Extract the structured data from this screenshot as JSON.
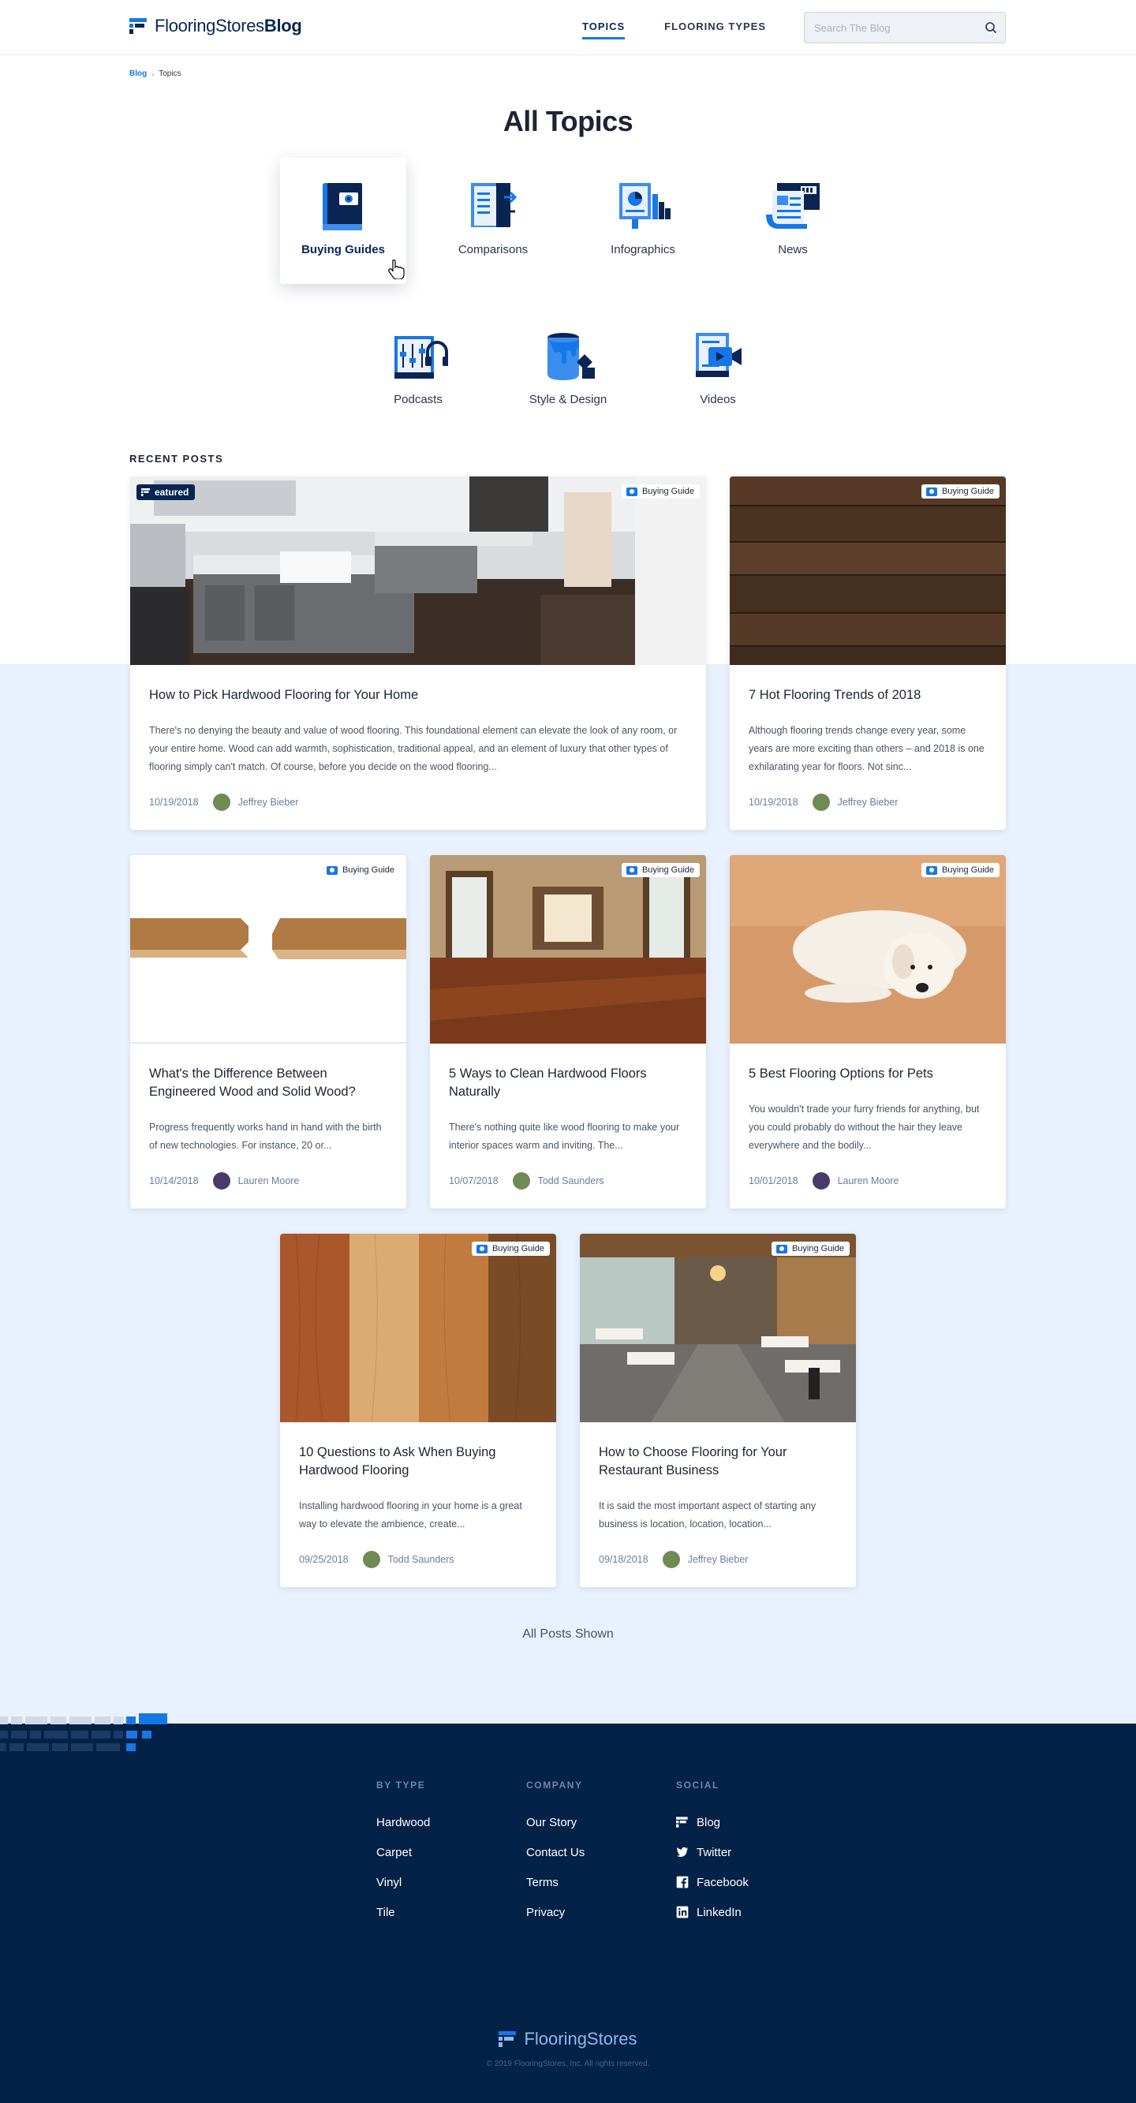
{
  "header": {
    "logo_text": "FlooringStores",
    "logo_blog": "Blog",
    "nav": [
      {
        "label": "TOPICS",
        "active": true
      },
      {
        "label": "FLOORING TYPES",
        "active": false
      }
    ],
    "search_placeholder": "Search The Blog"
  },
  "breadcrumb": {
    "root": "Blog",
    "current": "Topics"
  },
  "page_title": "All Topics",
  "topics": [
    {
      "label": "Buying Guides",
      "icon": "book-icon",
      "active": true
    },
    {
      "label": "Comparisons",
      "icon": "comparison-icon",
      "active": false
    },
    {
      "label": "Infographics",
      "icon": "chart-board-icon",
      "active": false
    },
    {
      "label": "News",
      "icon": "newspaper-icon",
      "active": false
    },
    {
      "label": "Podcasts",
      "icon": "podcast-icon",
      "active": false
    },
    {
      "label": "Style & Design",
      "icon": "paint-bucket-icon",
      "active": false
    },
    {
      "label": "Videos",
      "icon": "video-icon",
      "active": false
    }
  ],
  "recent_posts_label": "RECENT POSTS",
  "posts": [
    {
      "title": "How to Pick Hardwood Flooring for Your Home",
      "excerpt": "There's no denying the beauty and value of wood flooring.  This foundational element can elevate the look of any room, or your entire home.  Wood can add warmth, sophistication, traditional appeal, and an element of luxury that other types of flooring simply can't match.  Of course, before you decide on the wood flooring...",
      "date": "10/19/2018",
      "author": "Jeffrey Bieber",
      "badge": "Buying Guide",
      "featured": "eatured",
      "image": "kitchen-photo"
    },
    {
      "title": "7 Hot Flooring Trends of 2018",
      "excerpt": "Although flooring trends change every year, some years are more exciting than others – and 2018 is one exhilarating year for floors. Not sinc...",
      "date": "10/19/2018",
      "author": "Jeffrey Bieber",
      "badge": "Buying Guide",
      "image": "dark-wood-planks-photo"
    },
    {
      "title": "What's the Difference Between Engineered Wood and Solid Wood?",
      "excerpt": "Progress frequently works hand in hand with the birth of new technologies. For instance, 20 or...",
      "date": "10/14/2018",
      "author": "Lauren Moore",
      "badge": "Buying Guide",
      "image": "wood-plank-samples-photo"
    },
    {
      "title": "5 Ways to Clean Hardwood Floors Naturally",
      "excerpt": "There's nothing quite like wood flooring to make your interior spaces warm and inviting.  The...",
      "date": "10/07/2018",
      "author": "Todd Saunders",
      "badge": "Buying Guide",
      "image": "hardwood-room-photo"
    },
    {
      "title": "5 Best Flooring Options for Pets",
      "excerpt": "You wouldn't trade your furry friends for anything, but you could probably do without the hair they leave everywhere and the bodily...",
      "date": "10/01/2018",
      "author": "Lauren Moore",
      "badge": "Buying Guide",
      "image": "puppy-on-floor-photo"
    },
    {
      "title": "10 Questions to Ask When Buying Hardwood Flooring",
      "excerpt": "Installing hardwood flooring in your home is a great way to elevate the ambience, create...",
      "date": "09/25/2018",
      "author": "Todd Saunders",
      "badge": "Buying Guide",
      "image": "wood-swatches-photo"
    },
    {
      "title": "How to Choose Flooring for Your Restaurant Business",
      "excerpt": "It is said the most important aspect of starting any business is location, location, location...",
      "date": "09/18/2018",
      "author": "Jeffrey Bieber",
      "badge": "Buying Guide",
      "image": "restaurant-photo"
    }
  ],
  "all_shown": "All Posts Shown",
  "footer": {
    "columns": [
      {
        "heading": "BY TYPE",
        "items": [
          "Hardwood",
          "Carpet",
          "Vinyl",
          "Tile"
        ]
      },
      {
        "heading": "COMPANY",
        "items": [
          "Our Story",
          "Contact Us",
          "Terms",
          "Privacy"
        ]
      },
      {
        "heading": "SOCIAL",
        "items": [
          "Blog",
          "Twitter",
          "Facebook",
          "LinkedIn"
        ]
      }
    ],
    "logo_text": "FlooringStores",
    "copyright": "© 2019 FlooringStores, Inc. All rights reserved."
  },
  "colors": {
    "accent": "#1677e6",
    "navy": "#0a2552",
    "footer_bg": "#042147",
    "band_bg": "#e8f1fd"
  }
}
